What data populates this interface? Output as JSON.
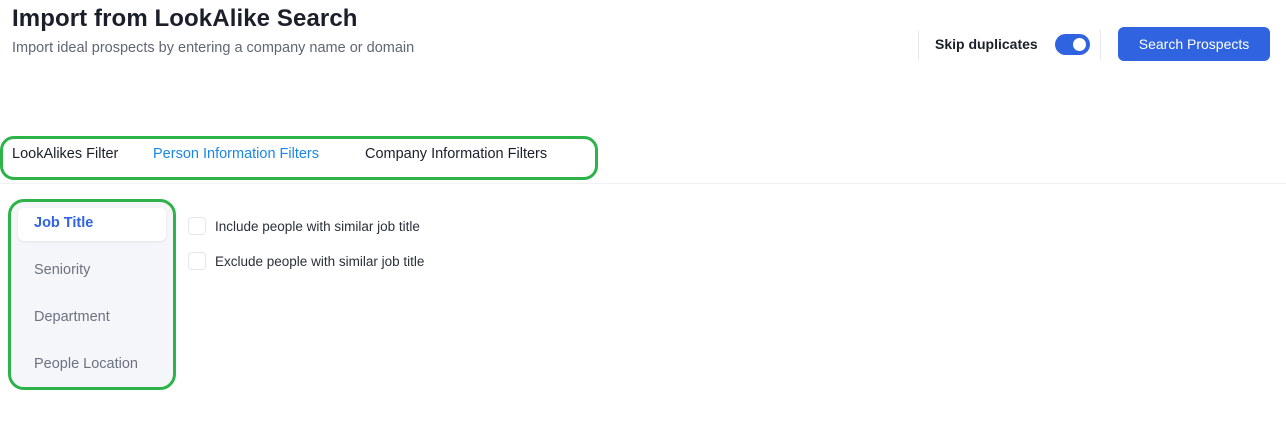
{
  "header": {
    "title": "Import from LookAlike Search",
    "subtitle": "Import ideal prospects by entering a company name or domain"
  },
  "controls": {
    "skip_duplicates_label": "Skip duplicates",
    "skip_duplicates_on": true,
    "search_button_label": "Search Prospects"
  },
  "tabs": [
    {
      "label": "LookAlikes Filter",
      "active": false
    },
    {
      "label": "Person Information Filters",
      "active": true
    },
    {
      "label": "Company Information Filters",
      "active": false
    }
  ],
  "sidebar": {
    "items": [
      {
        "label": "Job Title",
        "active": true
      },
      {
        "label": "Seniority",
        "active": false
      },
      {
        "label": "Department",
        "active": false
      },
      {
        "label": "People Location",
        "active": false
      }
    ]
  },
  "options": [
    {
      "label": "Include people with similar job title",
      "checked": false
    },
    {
      "label": "Exclude people with similar job title",
      "checked": false
    }
  ],
  "colors": {
    "accent": "#2f63e0",
    "active_tab": "#1a86e8",
    "highlight": "#2db34a"
  }
}
